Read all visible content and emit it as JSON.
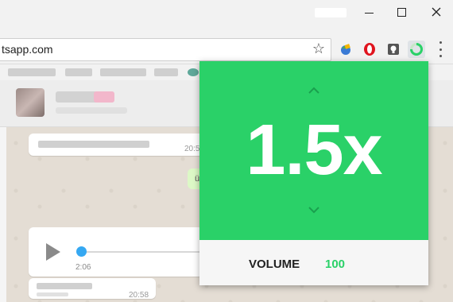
{
  "browser": {
    "url": "tsapp.com",
    "colors": {
      "chrome": "#f2f2f2"
    }
  },
  "chat": {
    "message_times": [
      "20:5",
      "20:58"
    ],
    "green_bubble_text": "ü",
    "audio_duration": "2:06"
  },
  "popup": {
    "speed": "1.5x",
    "volume_label": "VOLUME",
    "volume_value": "100",
    "colors": {
      "accent": "#2ad168",
      "text_on_accent": "#ffffff"
    }
  },
  "icons": [
    "minimize-icon",
    "maximize-icon",
    "close-icon",
    "star-icon",
    "extension-globe-icon",
    "opera-icon",
    "lightbulb-icon",
    "speed-extension-icon",
    "menu-dots-icon",
    "play-icon",
    "chevron-up-icon",
    "chevron-down-icon"
  ]
}
